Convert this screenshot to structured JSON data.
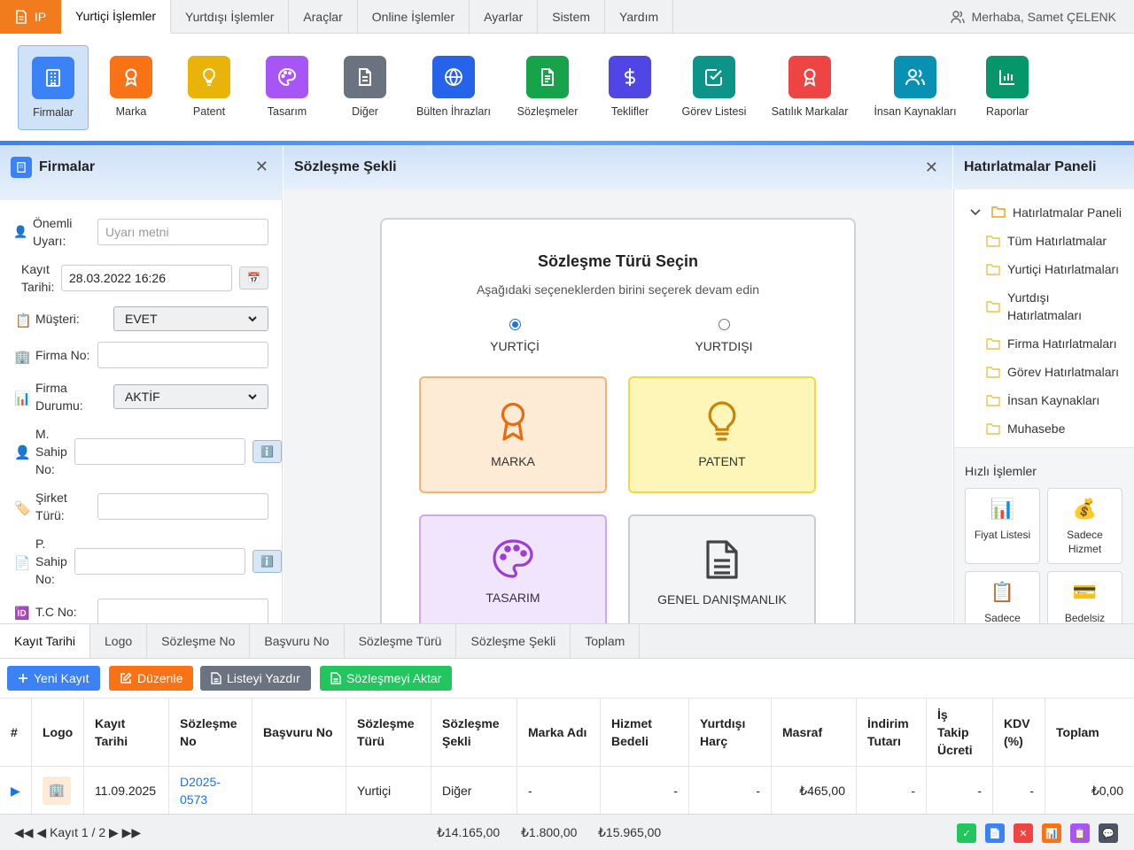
{
  "app": {
    "brand": "IP"
  },
  "menu": [
    "Yurtiçi İşlemler",
    "Yurtdışı İşlemler",
    "Araçlar",
    "Online İşlemler",
    "Ayarlar",
    "Sistem",
    "Yardım"
  ],
  "user": {
    "greeting": "Merhaba, Samet ÇELENK"
  },
  "toolbar": [
    {
      "label": "Firmalar",
      "color": "#3b82f6",
      "icon": "building-icon"
    },
    {
      "label": "Marka",
      "color": "#f97316",
      "icon": "award-icon"
    },
    {
      "label": "Patent",
      "color": "#eab308",
      "icon": "lightbulb-icon"
    },
    {
      "label": "Tasarım",
      "color": "#a855f7",
      "icon": "palette-icon"
    },
    {
      "label": "Diğer",
      "color": "#6b7280",
      "icon": "document-icon"
    },
    {
      "label": "Bülten İhrazları",
      "color": "#2563eb",
      "icon": "globe-icon"
    },
    {
      "label": "Sözleşmeler",
      "color": "#16a34a",
      "icon": "contract-icon"
    },
    {
      "label": "Teklifler",
      "color": "#4f46e5",
      "icon": "dollar-icon"
    },
    {
      "label": "Görev Listesi",
      "color": "#0d9488",
      "icon": "checkbox-icon"
    },
    {
      "label": "Satılık Markalar",
      "color": "#ef4444",
      "icon": "award-icon"
    },
    {
      "label": "İnsan Kaynakları",
      "color": "#0891b2",
      "icon": "users-icon"
    },
    {
      "label": "Raporlar",
      "color": "#059669",
      "icon": "chart-icon"
    }
  ],
  "left_panel": {
    "title": "Firmalar",
    "fields": {
      "onemli_uyari": {
        "label": "Önemli Uyarı:",
        "placeholder": "Uyarı metni"
      },
      "kayit_tarihi": {
        "label": "Kayıt Tarihi:",
        "value": "28.03.2022 16:26"
      },
      "musteri": {
        "label": "Müşteri:",
        "value": "EVET"
      },
      "firma_no": {
        "label": "Firma No:",
        "value": ""
      },
      "firma_durumu": {
        "label": "Firma Durumu:",
        "value": "AKTİF"
      },
      "m_sahip_no": {
        "label": "M. Sahip No:",
        "value": ""
      },
      "sirket_turu": {
        "label": "Şirket Türü:",
        "value": ""
      },
      "p_sahip_no": {
        "label": "P. Sahip No:",
        "value": ""
      },
      "tc_no": {
        "label": "T.C No:",
        "value": ""
      }
    }
  },
  "center_panel": {
    "title": "Sözleşme Şekli",
    "modal": {
      "title": "Sözleşme Türü Seçin",
      "subtitle": "Aşağıdaki seçeneklerden birini seçerek devam edin",
      "radio": [
        {
          "label": "YURTİÇİ",
          "checked": true
        },
        {
          "label": "YURTDIŞI",
          "checked": false
        }
      ],
      "options": [
        "MARKA",
        "PATENT",
        "TASARIM",
        "GENEL DANIŞMANLIK"
      ]
    }
  },
  "right_panel": {
    "title": "Hatırlatmalar Paneli",
    "tree_root": "Hatırlatmalar Paneli",
    "tree_items": [
      "Tüm Hatırlatmalar",
      "Yurtiçi Hatırlatmaları",
      "Yurtdışı Hatırlatmaları",
      "Firma Hatırlatmaları",
      "Görev Hatırlatmaları",
      "İnsan Kaynakları",
      "Muhasebe"
    ],
    "quick_title": "Hızlı İşlemler",
    "quick": [
      {
        "label": "Fiyat Listesi",
        "icon": "📊"
      },
      {
        "label": "Sadece Hizmet",
        "icon": "💰"
      },
      {
        "label": "Sadece",
        "icon": "📋"
      },
      {
        "label": "Bedelsiz",
        "icon": "💳"
      }
    ]
  },
  "bottom_tabs": [
    "Kayıt Tarihi",
    "Logo",
    "Sözleşme No",
    "Başvuru No",
    "Sözleşme Türü",
    "Sözleşme Şekli",
    "Toplam"
  ],
  "actions": {
    "new": "Yeni Kayıt",
    "edit": "Düzenle",
    "print": "Listeyi Yazdır",
    "transfer": "Sözleşmeyi Aktar"
  },
  "table": {
    "columns": [
      "#",
      "Logo",
      "Kayıt Tarihi",
      "Sözleşme No",
      "Başvuru No",
      "Sözleşme Türü",
      "Sözleşme Şekli",
      "Marka Adı",
      "Hizmet Bedeli",
      "Yurtdışı Harç",
      "Masraf",
      "İndirim Tutarı",
      "İş Takip Ücreti",
      "KDV (%)",
      "Toplam"
    ],
    "rows": [
      {
        "marker": "▶",
        "logo": "🏢",
        "kayit_tarihi": "11.09.2025",
        "sozlesme_no": "D2025-0573",
        "basvuru_no": "",
        "sozlesme_turu": "Yurtiçi",
        "sozlesme_sekli": "Diğer",
        "marka_adi": "-",
        "hizmet_bedeli": "-",
        "yurtdisi_harc": "-",
        "masraf": "₺465,00",
        "indirim_tutari": "-",
        "is_takip_ucreti": "-",
        "kdv": "-",
        "toplam": "₺0,00"
      }
    ]
  },
  "footer": {
    "nav": "◀◀ ◀ Kayıt 1 / 2 ▶ ▶▶",
    "totals": [
      "₺14.165,00",
      "₺1.800,00",
      "₺15.965,00"
    ]
  }
}
